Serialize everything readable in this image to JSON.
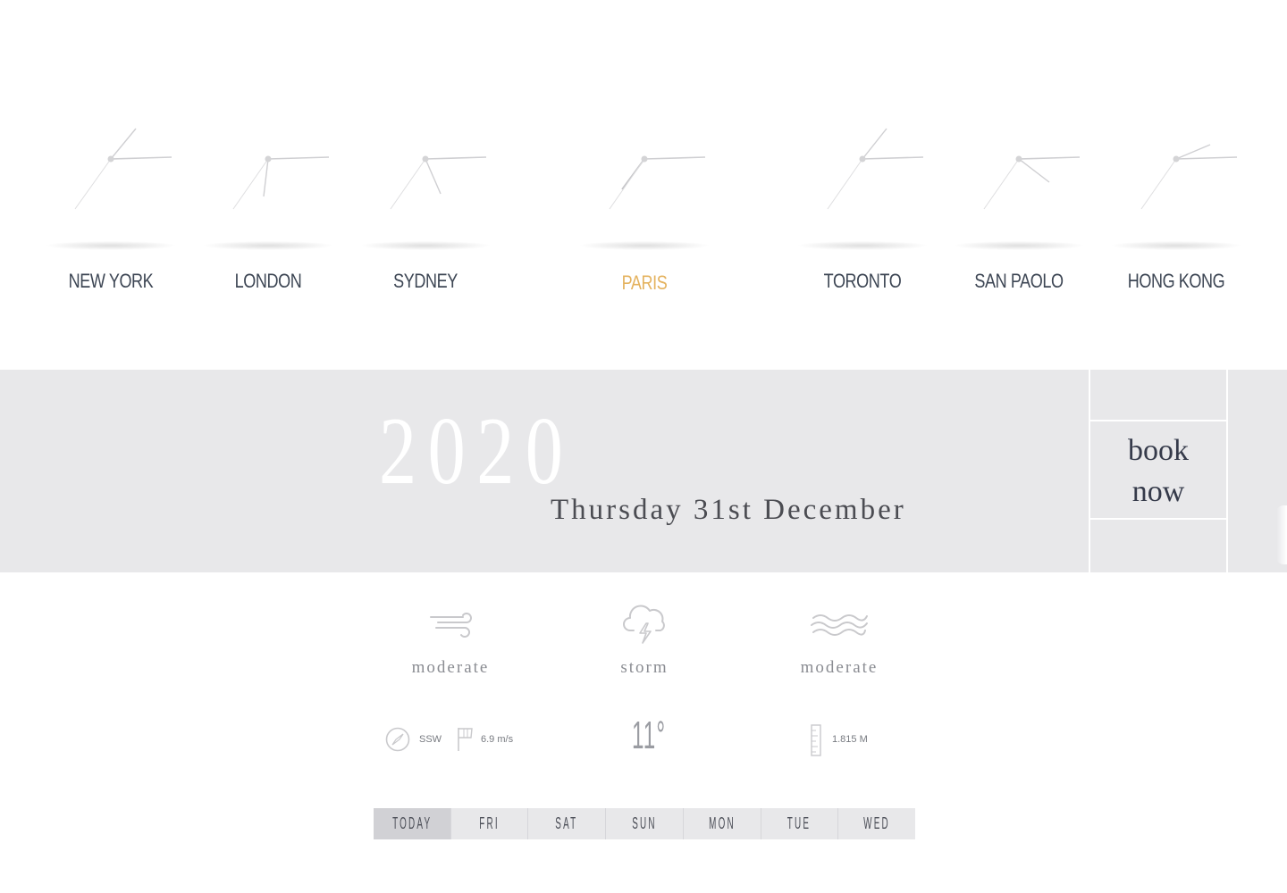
{
  "clocks": [
    {
      "city": "NEW YORK",
      "active": false
    },
    {
      "city": "LONDON",
      "active": false
    },
    {
      "city": "SYDNEY",
      "active": false
    },
    {
      "city": "PARIS",
      "active": true
    },
    {
      "city": "TORONTO",
      "active": false
    },
    {
      "city": "SAN PAOLO",
      "active": false
    },
    {
      "city": "HONG KONG",
      "active": false
    }
  ],
  "banner": {
    "year": "2020",
    "date": "Thursday 31st December",
    "book_line1": "book",
    "book_line2": "now"
  },
  "weather": {
    "wind_label": "moderate",
    "condition_label": "storm",
    "wave_label": "moderate",
    "wind_direction": "SSW",
    "wind_speed": "6.9 m/s",
    "temperature": "11°",
    "wave_height": "1.815 M"
  },
  "days": [
    {
      "label": "TODAY",
      "active": true
    },
    {
      "label": "FRI",
      "active": false
    },
    {
      "label": "SAT",
      "active": false
    },
    {
      "label": "SUN",
      "active": false
    },
    {
      "label": "MON",
      "active": false
    },
    {
      "label": "TUE",
      "active": false
    },
    {
      "label": "WED",
      "active": false
    }
  ],
  "colors": {
    "accent": "#e4b25e",
    "band": "#e8e8ea",
    "text_dark": "#3d4654"
  },
  "icons": {
    "wind": "wind-icon",
    "storm": "storm-cloud-icon",
    "waves": "waves-icon",
    "compass": "compass-icon",
    "windsock": "windsock-icon",
    "ruler": "ruler-icon"
  }
}
